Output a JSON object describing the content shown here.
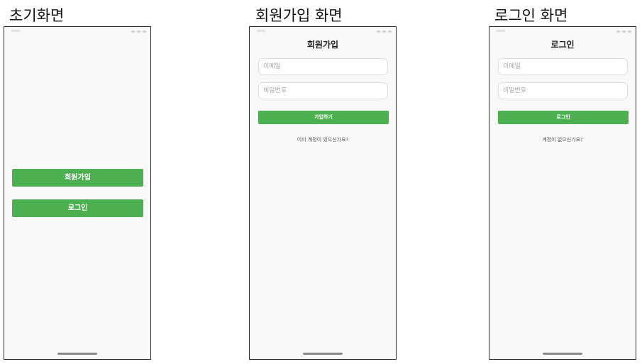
{
  "captions": {
    "initial": "초기화면",
    "signup": "회원가입 화면",
    "login": "로그인 화면"
  },
  "initial_screen": {
    "signup_button": "회원가입",
    "login_button": "로그인"
  },
  "signup_screen": {
    "title": "회원가입",
    "email_placeholder": "이메일",
    "password_placeholder": "비밀번호",
    "submit_button": "가입하기",
    "login_link": "이미 계정이 있으신가요?"
  },
  "login_screen": {
    "title": "로그인",
    "email_placeholder": "이메일",
    "password_placeholder": "비밀번호",
    "submit_button": "로그인",
    "signup_link": "계정이 없으신가요?"
  },
  "colors": {
    "accent": "#4caf50",
    "screen_background": "#f8f8f8"
  }
}
